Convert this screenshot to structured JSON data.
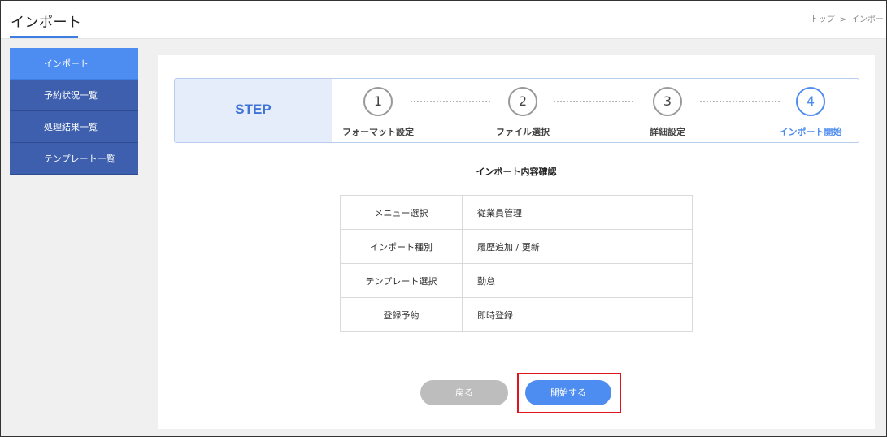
{
  "header": {
    "title": "インポート",
    "breadcrumb": [
      "トップ",
      ">",
      "インポー"
    ]
  },
  "sidebar": {
    "items": [
      {
        "label": "インポート",
        "active": true
      },
      {
        "label": "予約状況一覧",
        "active": false
      },
      {
        "label": "処理結果一覧",
        "active": false
      },
      {
        "label": "テンプレート一覧",
        "active": false
      }
    ]
  },
  "stepper": {
    "label": "STEP",
    "steps": [
      {
        "number": "1",
        "label": "フォーマット設定",
        "active": false
      },
      {
        "number": "2",
        "label": "ファイル選択",
        "active": false
      },
      {
        "number": "3",
        "label": "詳細設定",
        "active": false
      },
      {
        "number": "4",
        "label": "インポート開始",
        "active": true
      }
    ]
  },
  "confirmation": {
    "title": "インポート内容確認",
    "rows": [
      {
        "key": "メニュー選択",
        "value": "従業員管理"
      },
      {
        "key": "インポート種別",
        "value": "履歴追加 / 更新"
      },
      {
        "key": "テンプレート選択",
        "value": "勤怠"
      },
      {
        "key": "登録予約",
        "value": "即時登録"
      }
    ]
  },
  "actions": {
    "back_label": "戻る",
    "start_label": "開始する"
  },
  "colors": {
    "accent": "#4d8cf0",
    "sidebar": "#3d5fae",
    "highlight": "#e0141c"
  }
}
